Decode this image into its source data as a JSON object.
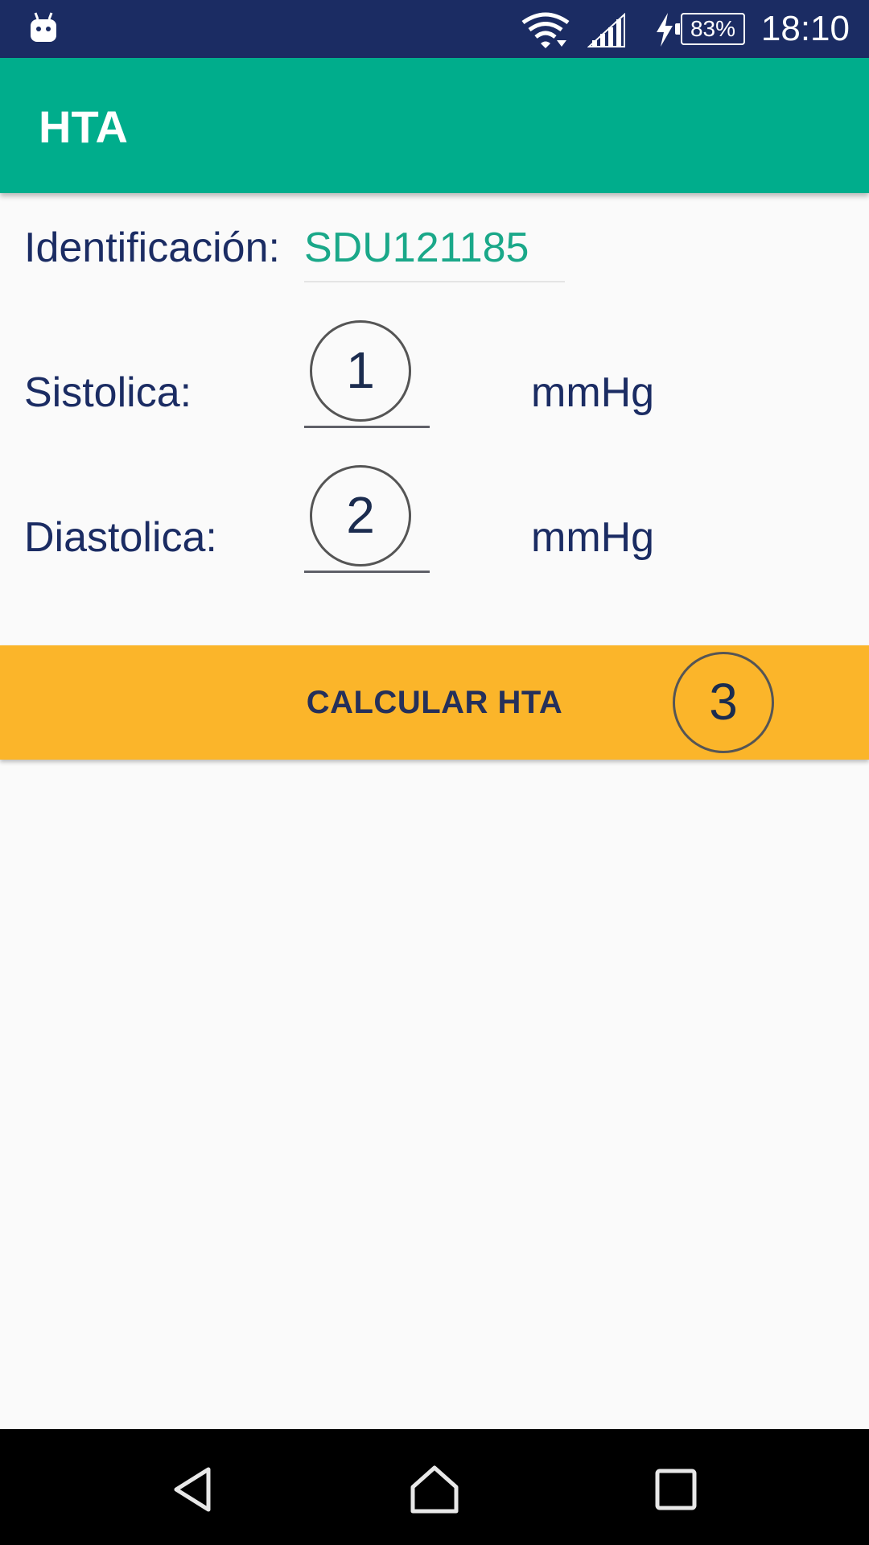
{
  "status_bar": {
    "battery": "83%",
    "time": "18:10",
    "icons": [
      "android-icon",
      "wifi-icon",
      "signal-icon",
      "charging-icon",
      "battery-icon"
    ]
  },
  "app_bar": {
    "title": "HTA"
  },
  "form": {
    "identification": {
      "label": "Identificación:",
      "value": "SDU121185"
    },
    "systolic": {
      "label": "Sistolica:",
      "value": "",
      "unit": "mmHg",
      "marker": "1"
    },
    "diastolic": {
      "label": "Diastolica:",
      "value": "",
      "unit": "mmHg",
      "marker": "2"
    }
  },
  "button": {
    "label": "CALCULAR HTA",
    "marker": "3"
  },
  "nav_bar": {
    "icons": [
      "back-icon",
      "home-icon",
      "recents-icon"
    ]
  },
  "colors": {
    "status_bar": "#1b2c63",
    "app_bar": "#00ad8c",
    "button": "#fbb52a",
    "text_primary": "#1b2c63",
    "id_value": "#1aa889"
  }
}
